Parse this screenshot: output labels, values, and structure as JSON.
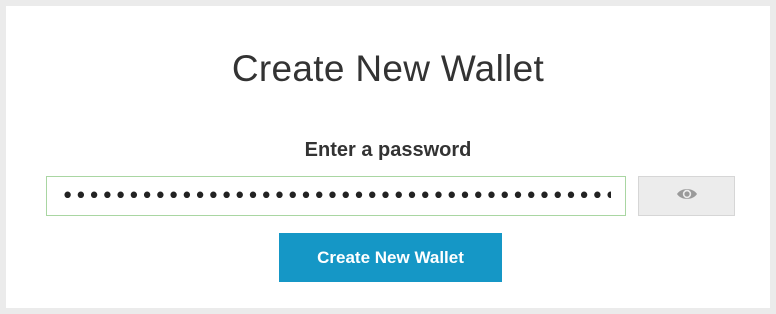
{
  "page": {
    "title": "Create New Wallet"
  },
  "password": {
    "label": "Enter a password",
    "masked_value": "••••••••••••••••••••••••••••••••••••••••••••"
  },
  "toggle_visibility": {
    "icon": "eye-icon"
  },
  "submit": {
    "label": "Create New Wallet"
  },
  "colors": {
    "primary_button": "#1597c6",
    "input_border": "#a9d6a2",
    "toggle_bg": "#ececec",
    "page_bg": "#ebebeb",
    "text": "#333333"
  }
}
